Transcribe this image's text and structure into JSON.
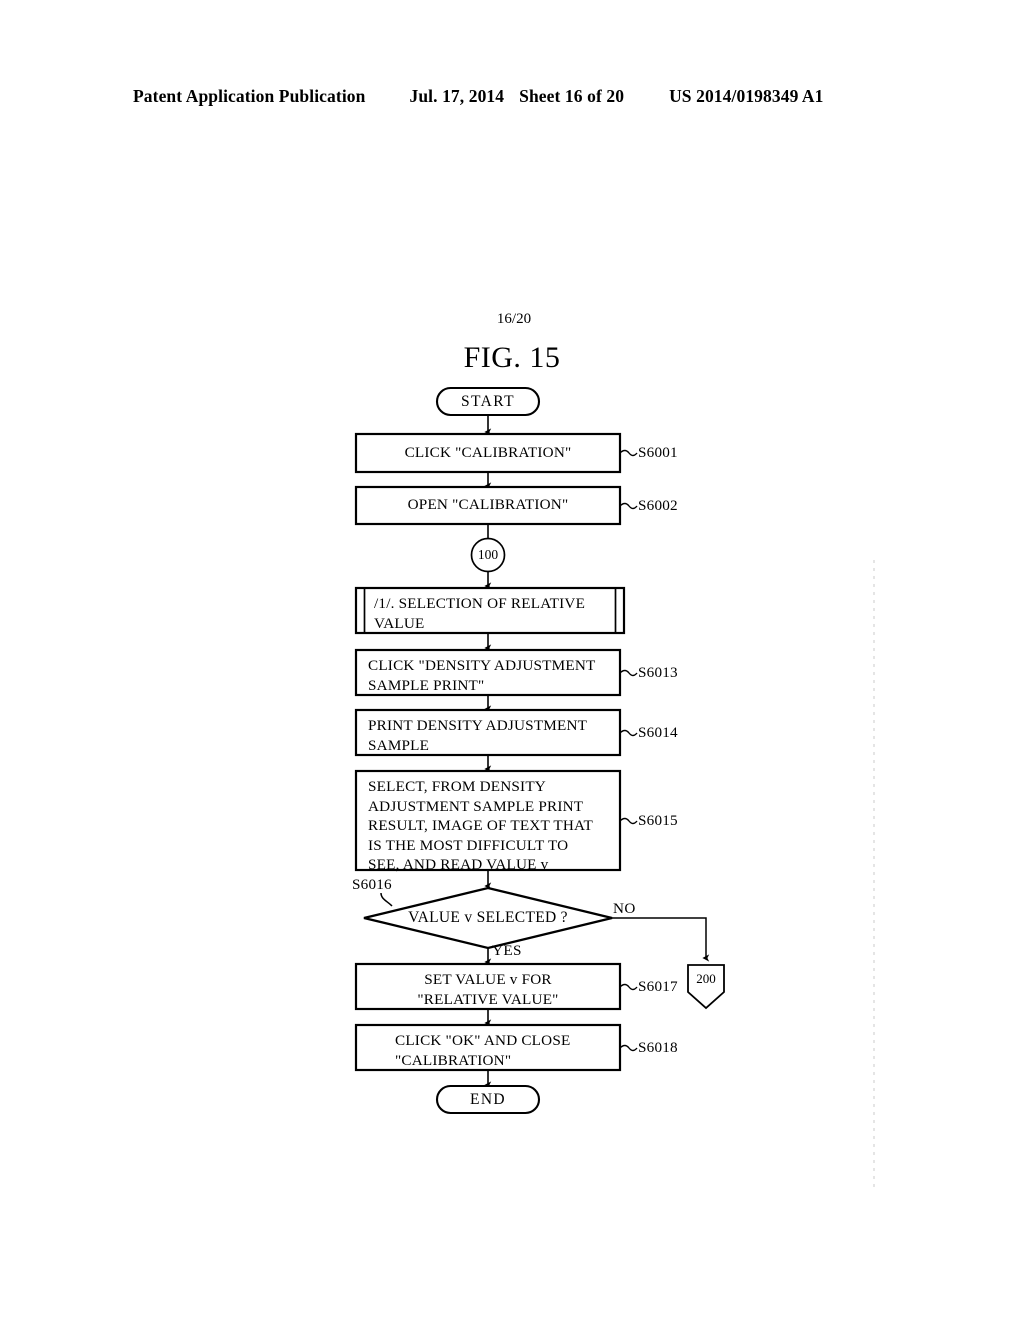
{
  "header": {
    "publication": "Patent Application Publication",
    "date": "Jul. 17, 2014",
    "sheet": "Sheet 16 of 20",
    "patent_number": "US 2014/0198349 A1"
  },
  "sheet_number": "16/20",
  "figure_title": "FIG. 15",
  "flowchart": {
    "start_label": "START",
    "end_label": "END",
    "entry_connector": "100",
    "exit_connector": "200",
    "branch_no": "NO",
    "branch_yes": "YES",
    "decision": {
      "text": "VALUE v SELECTED ?",
      "step": "S6016"
    },
    "steps": [
      {
        "text": "CLICK \"CALIBRATION\"",
        "step": "S6001",
        "align": "center"
      },
      {
        "text": "OPEN \"CALIBRATION\"",
        "step": "S6002",
        "align": "center"
      },
      {
        "text": "/1/. SELECTION OF RELATIVE\nVALUE",
        "step": "",
        "align": "left"
      },
      {
        "text": "CLICK \"DENSITY ADJUSTMENT\nSAMPLE PRINT\"",
        "step": "S6013",
        "align": "left"
      },
      {
        "text": "PRINT DENSITY ADJUSTMENT\nSAMPLE",
        "step": "S6014",
        "align": "left"
      },
      {
        "text": "SELECT, FROM DENSITY\nADJUSTMENT SAMPLE PRINT\nRESULT, IMAGE OF TEXT THAT\nIS THE MOST DIFFICULT TO\nSEE, AND READ VALUE v",
        "step": "S6015",
        "align": "left"
      },
      {
        "text": "SET VALUE v FOR\n\"RELATIVE VALUE\"",
        "step": "S6017",
        "align": "center"
      },
      {
        "text": "CLICK \"OK\" AND CLOSE\n\"CALIBRATION\"",
        "step": "S6018",
        "align": "left"
      }
    ]
  },
  "colors": {
    "ink": "#000000",
    "paper": "#ffffff"
  }
}
